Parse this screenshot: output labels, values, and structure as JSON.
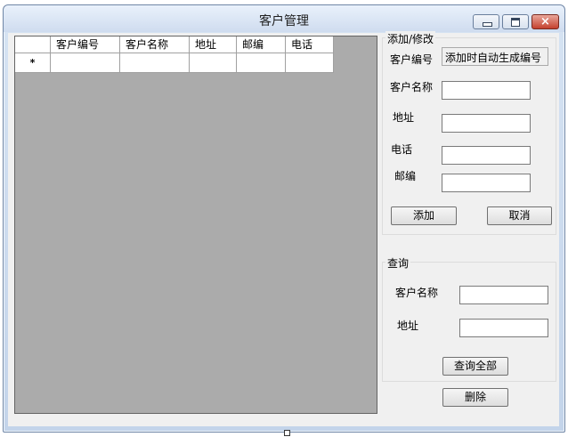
{
  "window": {
    "title": "客户管理",
    "buttons": {
      "minimize": "minimize-icon",
      "maximize": "maximize-icon",
      "close": "×"
    }
  },
  "grid": {
    "columns": [
      "客户编号",
      "客户名称",
      "地址",
      "邮编",
      "电话"
    ],
    "new_row_marker": "*"
  },
  "edit_group": {
    "legend": "添加/修改",
    "id_label": "客户编号",
    "id_value": "添加时自动生成编号",
    "name_label": "客户名称",
    "name_value": "",
    "address_label": "地址",
    "address_value": "",
    "phone_label": "电话",
    "phone_value": "",
    "zip_label": "邮编",
    "zip_value": "",
    "add_label": "添加",
    "cancel_label": "取消"
  },
  "query_group": {
    "legend": "查询",
    "name_label": "客户名称",
    "name_value": "",
    "address_label": "地址",
    "address_value": "",
    "query_all_label": "查询全部"
  },
  "delete_label": "删除"
}
